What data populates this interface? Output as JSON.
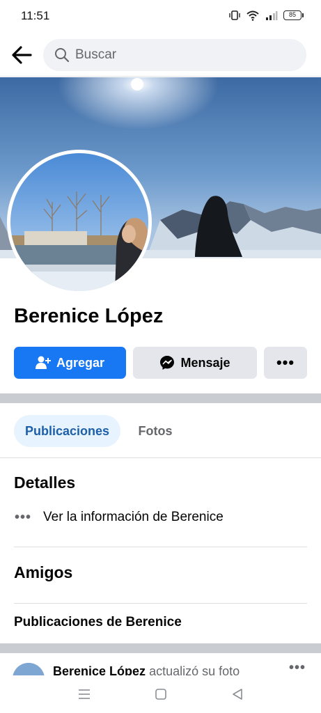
{
  "status_bar": {
    "time": "11:51",
    "battery": "85"
  },
  "search": {
    "placeholder": "Buscar"
  },
  "profile": {
    "name": "Berenice López"
  },
  "actions": {
    "add_label": "Agregar",
    "message_label": "Mensaje",
    "more_label": "•••"
  },
  "tabs": [
    {
      "label": "Publicaciones",
      "active": true
    },
    {
      "label": "Fotos",
      "active": false
    }
  ],
  "details": {
    "title": "Detalles",
    "info_label": "Ver la información de Berenice"
  },
  "friends": {
    "title": "Amigos"
  },
  "posts": {
    "title": "Publicaciones de Berenice",
    "first": {
      "author": "Berenice López",
      "action": "actualizó su foto"
    }
  },
  "colors": {
    "accent": "#1877f2",
    "tab_active_bg": "#e7f3ff",
    "tab_active_text": "#1d5fa8",
    "button_gray": "#e4e6eb",
    "divider": "#c9ccd1"
  },
  "icons": [
    "back-arrow-icon",
    "search-icon",
    "add-friend-icon",
    "messenger-icon",
    "more-dots-icon",
    "menu-icon",
    "home-square-icon",
    "back-triangle-icon"
  ]
}
